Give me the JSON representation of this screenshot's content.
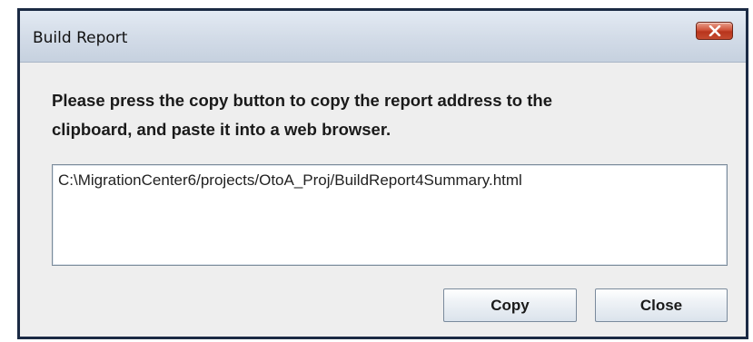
{
  "window": {
    "title": "Build Report"
  },
  "message": {
    "line1": "Please press the copy button to copy the report address to the",
    "line2": "clipboard, and paste it into a web browser."
  },
  "report": {
    "path": "C:\\MigrationCenter6/projects/OtoA_Proj/BuildReport4Summary.html"
  },
  "buttons": {
    "copy_label": "Copy",
    "close_label": "Close"
  },
  "icons": {
    "titlebar_close": "close-x-icon"
  },
  "colors": {
    "close_button": "#c9462c",
    "frame": "#1b2a44",
    "titlebar": "#d2dbe7",
    "body": "#eeeeee"
  }
}
